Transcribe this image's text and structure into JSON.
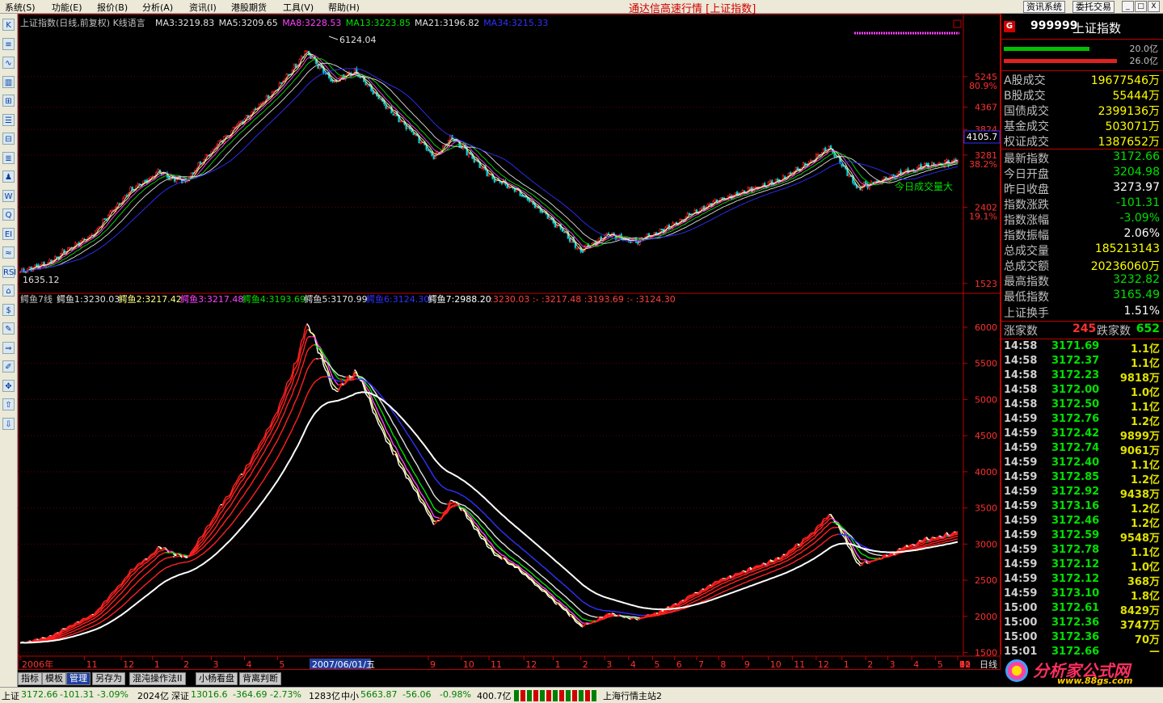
{
  "menu": [
    "系统(S)",
    "功能(E)",
    "报价(B)",
    "分析(A)",
    "资讯(I)",
    "港股期货",
    "工具(V)",
    "帮助(H)"
  ],
  "app_title": "通达信高速行情 [上证指数]",
  "title_buttons": [
    "资讯系统",
    "委托交易"
  ],
  "window_buttons": [
    "_",
    "□",
    "X"
  ],
  "toolbar_icons": [
    "K",
    "≡",
    "∿",
    "▥",
    "⊞",
    "☰",
    "⊟",
    "≣",
    "♟",
    "W",
    "Q",
    "EI",
    "≈",
    "RSI",
    "⌂",
    "$",
    "✎",
    "⇒",
    "✐",
    "✥",
    "⇧",
    "⇩"
  ],
  "colors": {
    "up": "#ff2020",
    "down": "#00e0e0",
    "accent": "#c00000",
    "green": "#00e000",
    "yellow": "#ffff00",
    "magenta": "#ff40ff",
    "blue": "#3030ff"
  },
  "upper_header": {
    "name": "上证指数(日线,前复权) K线语言",
    "ma": [
      {
        "label": "MA3:3219.83",
        "color": "#e0e0e0"
      },
      {
        "label": "MA5:3209.65",
        "color": "#e0e0e0"
      },
      {
        "label": "MA8:3228.53",
        "color": "#ff40ff"
      },
      {
        "label": "MA13:3223.85",
        "color": "#00e000"
      },
      {
        "label": "MA21:3196.82",
        "color": "#e0e0e0"
      },
      {
        "label": "MA34:3215.33",
        "color": "#3030ff"
      }
    ]
  },
  "lower_header": {
    "name": "鳄鱼7线",
    "items": [
      {
        "label": "鳄鱼1:3230.03",
        "color": "#e0e0e0"
      },
      {
        "label": "鳄鱼2:3217.42",
        "color": "#ffff80"
      },
      {
        "label": "鳄鱼3:3217.48",
        "color": "#ff40ff"
      },
      {
        "label": "鳄鱼4:3193.69",
        "color": "#00e000"
      },
      {
        "label": "鳄鱼5:3170.99",
        "color": "#e0e0e0"
      },
      {
        "label": "鳄鱼6:3124.30",
        "color": "#3030ff"
      },
      {
        "label": "鳄鱼7:2988.20",
        "color": "#ffffff"
      },
      {
        "label": ":3230.03 :- :3217.48 :3193.69 :- :3124.30",
        "color": "#ff4040"
      }
    ]
  },
  "annotations": {
    "high": "6124.04",
    "low": "1635.12",
    "right_label": "今日成交量大",
    "current_price_box": "4105.7"
  },
  "chart_data": [
    {
      "type": "line",
      "panel": "upper",
      "series_name": "上证指数",
      "y_scale": "log",
      "ylim": [
        1450,
        7000
      ],
      "y_ticks": [
        {
          "v": 5245,
          "label": "5245",
          "pct": "80.9%"
        },
        {
          "v": 4367,
          "label": "4367",
          "pct": ""
        },
        {
          "v": 3824,
          "label": "3824",
          "pct": ""
        },
        {
          "v": 3281,
          "label": "3281",
          "pct": "38.2%"
        },
        {
          "v": 2402,
          "label": "2402",
          "pct": "19.1%"
        },
        {
          "v": 1523,
          "label": "1523",
          "pct": ""
        }
      ],
      "anchors": [
        [
          0,
          1635
        ],
        [
          15,
          1720
        ],
        [
          40,
          2050
        ],
        [
          60,
          2650
        ],
        [
          75,
          2950
        ],
        [
          90,
          2800
        ],
        [
          110,
          3600
        ],
        [
          125,
          4200
        ],
        [
          140,
          4900
        ],
        [
          150,
          5600
        ],
        [
          155,
          6124
        ],
        [
          170,
          5050
        ],
        [
          182,
          5400
        ],
        [
          195,
          4600
        ],
        [
          210,
          3900
        ],
        [
          225,
          3250
        ],
        [
          235,
          3650
        ],
        [
          255,
          2900
        ],
        [
          270,
          2650
        ],
        [
          290,
          2200
        ],
        [
          305,
          1850
        ],
        [
          320,
          2050
        ],
        [
          335,
          1950
        ],
        [
          350,
          2100
        ],
        [
          375,
          2450
        ],
        [
          400,
          2700
        ],
        [
          415,
          2850
        ],
        [
          430,
          3150
        ],
        [
          440,
          3450
        ],
        [
          455,
          2700
        ],
        [
          470,
          2850
        ],
        [
          490,
          3050
        ],
        [
          510,
          3172
        ]
      ]
    },
    {
      "type": "line",
      "panel": "lower",
      "series_name": "鳄鱼7线",
      "ylim": [
        1450,
        6200
      ],
      "y_ticks": [
        6000,
        5500,
        5000,
        4500,
        4000,
        3500,
        3000,
        2500,
        2000,
        1500
      ],
      "anchors": [
        [
          0,
          1635
        ],
        [
          15,
          1720
        ],
        [
          40,
          2050
        ],
        [
          60,
          2650
        ],
        [
          75,
          2950
        ],
        [
          90,
          2800
        ],
        [
          110,
          3600
        ],
        [
          125,
          4200
        ],
        [
          140,
          4900
        ],
        [
          150,
          5600
        ],
        [
          155,
          6124
        ],
        [
          170,
          5050
        ],
        [
          182,
          5400
        ],
        [
          195,
          4600
        ],
        [
          210,
          3900
        ],
        [
          225,
          3250
        ],
        [
          235,
          3650
        ],
        [
          255,
          2900
        ],
        [
          270,
          2650
        ],
        [
          290,
          2200
        ],
        [
          305,
          1850
        ],
        [
          320,
          2050
        ],
        [
          335,
          1950
        ],
        [
          350,
          2100
        ],
        [
          375,
          2450
        ],
        [
          400,
          2700
        ],
        [
          415,
          2850
        ],
        [
          430,
          3150
        ],
        [
          440,
          3450
        ],
        [
          455,
          2700
        ],
        [
          470,
          2850
        ],
        [
          490,
          3050
        ],
        [
          510,
          3172
        ]
      ]
    }
  ],
  "x_axis": {
    "labels": [
      {
        "t": "2006年",
        "i": 0
      },
      {
        "t": "11",
        "i": 35
      },
      {
        "t": "12",
        "i": 55
      },
      {
        "t": "1",
        "i": 72
      },
      {
        "t": "2",
        "i": 88
      },
      {
        "t": "3",
        "i": 104
      },
      {
        "t": "4",
        "i": 122
      },
      {
        "t": "5",
        "i": 140
      },
      {
        "t": "2007/06/01/五",
        "i": 160
      },
      {
        "t": "9",
        "i": 222
      },
      {
        "t": "10",
        "i": 240
      },
      {
        "t": "11",
        "i": 255
      },
      {
        "t": "12",
        "i": 274
      },
      {
        "t": "1",
        "i": 290
      },
      {
        "t": "2",
        "i": 305
      },
      {
        "t": "3",
        "i": 318
      },
      {
        "t": "4",
        "i": 331
      },
      {
        "t": "5",
        "i": 344
      },
      {
        "t": "6",
        "i": 356
      },
      {
        "t": "7",
        "i": 368
      },
      {
        "t": "8",
        "i": 380
      },
      {
        "t": "9",
        "i": 393
      },
      {
        "t": "10",
        "i": 407
      },
      {
        "t": "11",
        "i": 420
      },
      {
        "t": "12",
        "i": 433
      },
      {
        "t": "1",
        "i": 447
      },
      {
        "t": "2",
        "i": 460
      },
      {
        "t": "3",
        "i": 472
      },
      {
        "t": "4",
        "i": 485
      },
      {
        "t": "5",
        "i": 498
      },
      {
        "t": "6",
        "i": 512
      },
      {
        "t": "7",
        "i": 525
      },
      {
        "t": "8",
        "i": 538
      },
      {
        "t": "9",
        "i": 551
      },
      {
        "t": "10",
        "i": 563
      },
      {
        "t": "11",
        "i": 576
      },
      {
        "t": "12",
        "i": 589
      },
      {
        "t": "1",
        "i": 603
      }
    ],
    "period": "日线"
  },
  "right_panel": {
    "code": "999999",
    "name": "上证指数",
    "bar_top": "20.0亿",
    "bar_bottom": "26.0亿",
    "rows": [
      {
        "l": "A股成交",
        "v": "19677546万",
        "c": "#ffff00"
      },
      {
        "l": "B股成交",
        "v": "55444万",
        "c": "#ffff00"
      },
      {
        "l": "国债成交",
        "v": "2399136万",
        "c": "#ffff00"
      },
      {
        "l": "基金成交",
        "v": "503071万",
        "c": "#ffff00"
      },
      {
        "l": "权证成交",
        "v": "1387652万",
        "c": "#ffff00"
      },
      {
        "l": "最新指数",
        "v": "3172.66",
        "c": "#00e000"
      },
      {
        "l": "今日开盘",
        "v": "3204.98",
        "c": "#00e000"
      },
      {
        "l": "昨日收盘",
        "v": "3273.97",
        "c": "#ffffff"
      },
      {
        "l": "指数涨跌",
        "v": "-101.31",
        "c": "#00e000"
      },
      {
        "l": "指数涨幅",
        "v": "-3.09%",
        "c": "#00e000"
      },
      {
        "l": "指数振幅",
        "v": "2.06%",
        "c": "#ffffff"
      },
      {
        "l": "总成交量",
        "v": "185213143",
        "c": "#ffff00"
      },
      {
        "l": "总成交额",
        "v": "20236060万",
        "c": "#ffff00"
      },
      {
        "l": "最高指数",
        "v": "3232.82",
        "c": "#00e000"
      },
      {
        "l": "最低指数",
        "v": "3165.49",
        "c": "#00e000"
      },
      {
        "l": "上证换手",
        "v": "1.51%",
        "c": "#ffffff"
      }
    ],
    "adv_label": "涨家数",
    "adv": "245",
    "dec_label": "跌家数",
    "dec": "652",
    "ticks": [
      [
        "14:58",
        "3171.69",
        "1.1亿"
      ],
      [
        "14:58",
        "3172.37",
        "1.1亿"
      ],
      [
        "14:58",
        "3172.23",
        "9818万"
      ],
      [
        "14:58",
        "3172.00",
        "1.0亿"
      ],
      [
        "14:58",
        "3172.50",
        "1.1亿"
      ],
      [
        "14:59",
        "3172.76",
        "1.2亿"
      ],
      [
        "14:59",
        "3172.42",
        "9899万"
      ],
      [
        "14:59",
        "3172.74",
        "9061万"
      ],
      [
        "14:59",
        "3172.40",
        "1.1亿"
      ],
      [
        "14:59",
        "3172.85",
        "1.2亿"
      ],
      [
        "14:59",
        "3172.92",
        "9438万"
      ],
      [
        "14:59",
        "3173.16",
        "1.2亿"
      ],
      [
        "14:59",
        "3172.46",
        "1.2亿"
      ],
      [
        "14:59",
        "3172.59",
        "9548万"
      ],
      [
        "14:59",
        "3172.78",
        "1.1亿"
      ],
      [
        "14:59",
        "3172.12",
        "1.0亿"
      ],
      [
        "14:59",
        "3172.12",
        "368万"
      ],
      [
        "14:59",
        "3173.10",
        "1.8亿"
      ],
      [
        "15:00",
        "3172.61",
        "8429万"
      ],
      [
        "15:00",
        "3172.36",
        "3747万"
      ],
      [
        "15:00",
        "3172.36",
        "70万"
      ],
      [
        "15:01",
        "3172.66",
        "—"
      ]
    ]
  },
  "bottom_tabs": [
    "指标",
    "模板",
    "管理",
    "另存为",
    "混沌操作法II",
    "小杨看盘",
    "背离判断"
  ],
  "period_tab": "日线",
  "status": {
    "sh_label": "上证",
    "sh_val": "3172.66",
    "sh_chg": "-101.31",
    "sh_pct": "-3.09%",
    "sh_amt": "2024亿",
    "sz_label": "深证",
    "sz_val": "13016.6",
    "sz_chg": "-364.69",
    "sz_pct": "-2.73%",
    "sz_amt": "1283亿",
    "zx_label": "中小",
    "zx_val": "5663.87",
    "zx_chg": "-56.06",
    "zx_pct": "-0.98%",
    "zx_amt": "400.7亿",
    "server": "上海行情主站2"
  },
  "logo": {
    "text": "分析家公式网",
    "url": "www.88gs.com"
  }
}
